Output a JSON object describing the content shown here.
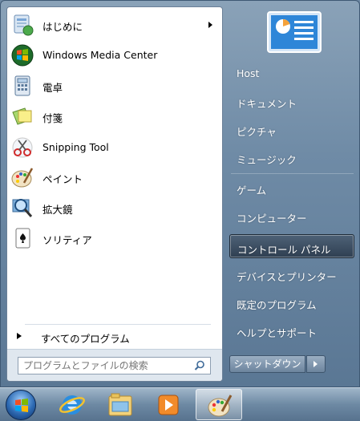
{
  "programs": [
    {
      "label": "はじめに",
      "icon": "getting-started-icon",
      "has_submenu": true
    },
    {
      "label": "Windows Media Center",
      "icon": "media-center-icon"
    },
    {
      "label": "電卓",
      "icon": "calculator-icon"
    },
    {
      "label": "付箋",
      "icon": "sticky-notes-icon"
    },
    {
      "label": "Snipping Tool",
      "icon": "scissors-icon"
    },
    {
      "label": "ペイント",
      "icon": "paint-icon"
    },
    {
      "label": "拡大鏡",
      "icon": "magnifier-icon"
    },
    {
      "label": "ソリティア",
      "icon": "solitaire-icon"
    }
  ],
  "all_programs": {
    "label": "すべてのプログラム"
  },
  "search": {
    "placeholder": "プログラムとファイルの検索",
    "value": ""
  },
  "right_pane": {
    "items": [
      {
        "label": "Host"
      },
      {
        "label": "ドキュメント"
      },
      {
        "label": "ピクチャ"
      },
      {
        "label": "ミュージック"
      },
      {
        "label": "ゲーム"
      },
      {
        "label": "コンピューター"
      },
      {
        "label": "コントロール パネル",
        "selected": true
      },
      {
        "label": "デバイスとプリンター"
      },
      {
        "label": "既定のプログラム"
      },
      {
        "label": "ヘルプとサポート"
      }
    ],
    "shutdown_label": "シャットダウン"
  },
  "taskbar": {
    "items": [
      "start-orb",
      "internet-explorer-icon",
      "file-explorer-icon",
      "media-player-icon",
      "paint-icon"
    ],
    "active": "paint-icon"
  }
}
